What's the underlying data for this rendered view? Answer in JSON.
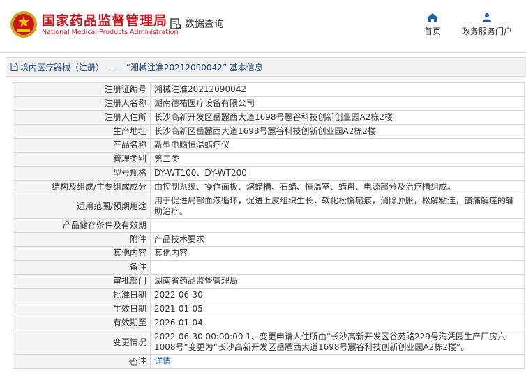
{
  "header": {
    "brand_cn": "国家药品监督管理局",
    "brand_en": "National Medical Products Administration",
    "search_label": "数据查询",
    "nav": [
      {
        "label": "首页",
        "icon": "home-icon"
      },
      {
        "label": "政务服务门户",
        "icon": "user-icon"
      }
    ],
    "brand_color": "#c9151e"
  },
  "breadcrumb": "境内医疗器械（注册） —— “湘械注准20212090042” 基本信息",
  "rows": [
    {
      "key": "注册证编号",
      "value": "湘械注准20212090042"
    },
    {
      "key": "注册人名称",
      "value": "湖南德祐医疗设备有限公司"
    },
    {
      "key": "注册人住所",
      "value": "长沙高新开发区岳麓西大道1698号麓谷科技创新创业园A2栋2楼"
    },
    {
      "key": "生产地址",
      "value": "长沙高新区岳麓西大道1698号麓谷科技创新创业园A2栋2楼"
    },
    {
      "key": "产品名称",
      "value": "新型电脑恒温蜡疗仪"
    },
    {
      "key": "管理类别",
      "value": "第二类"
    },
    {
      "key": "型号规格",
      "value": "DY-WT100、DY-WT200"
    },
    {
      "key": "结构及组成/主要组成成分",
      "value": "由控制系统、操作面板、熔蜡槽、石蜡、恒温室、蜡盘、电源部分及治疗槽组成。"
    },
    {
      "key": "适用范围/预期用途",
      "value": "用于促进局部血液循环，促进上皮组织生长，软化松懈瘢痕，消除肿胀，松解粘连，镇痛解痉的辅助治疗。"
    },
    {
      "key": "产品储存条件及有效期",
      "value": ""
    },
    {
      "key": "附件",
      "value": "产品技术要求"
    },
    {
      "key": "其他内容",
      "value": "其他内容"
    },
    {
      "key": "备注",
      "value": ""
    },
    {
      "key": "审批部门",
      "value": "湖南省药品监督管理局"
    },
    {
      "key": "批准日期",
      "value": "2022-06-30"
    },
    {
      "key": "生效日期",
      "value": "2021-01-05"
    },
    {
      "key": "有效期至",
      "value": "2026-01-04"
    },
    {
      "key": "变更情况",
      "value": "2022-06-30 00:00:00 1、变更申请人住所由“长沙高新开发区谷苑路229号海凭园生产厂房六1008号”变更为“长沙高新开发区岳麓西大道1698号麓谷科技创新创业园A2栋2楼”。"
    }
  ],
  "note_row": {
    "key": "注",
    "value": "详情"
  }
}
